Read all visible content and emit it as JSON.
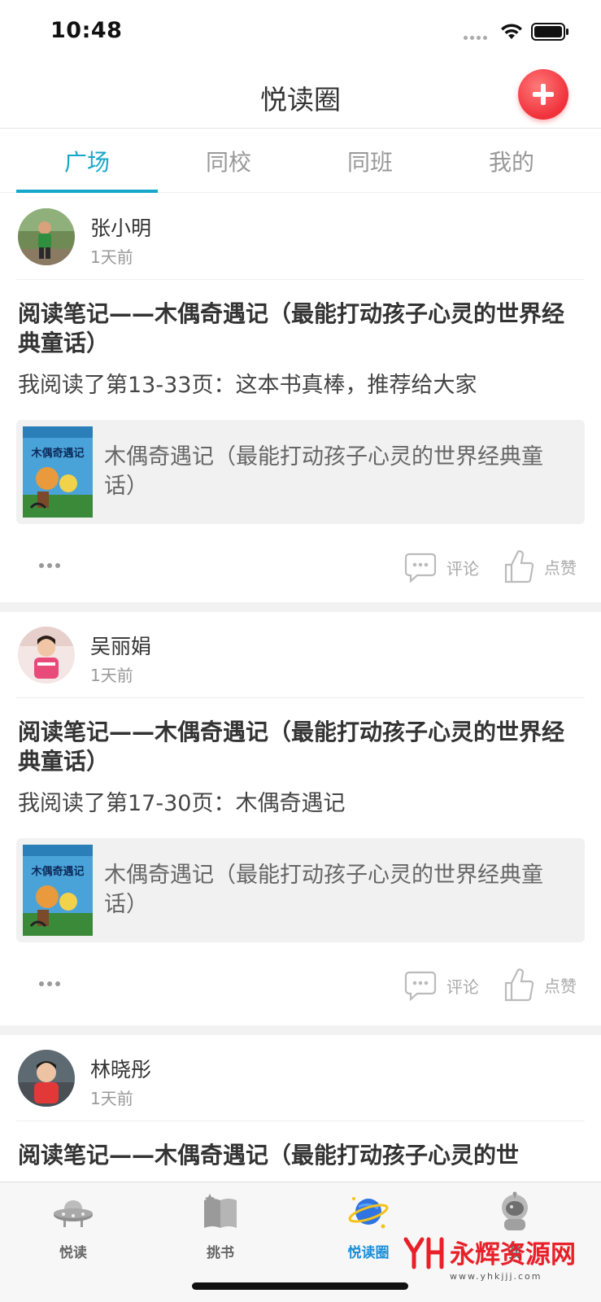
{
  "status_bar": {
    "time": "10:48"
  },
  "nav": {
    "title": "悦读圈"
  },
  "tabs": [
    {
      "label": "广场",
      "active": true
    },
    {
      "label": "同校",
      "active": false
    },
    {
      "label": "同班",
      "active": false
    },
    {
      "label": "我的",
      "active": false
    }
  ],
  "posts": [
    {
      "name": "张小明",
      "time": "1天前",
      "title": "阅读笔记——木偶奇遇记（最能打动孩子心灵的世界经典童话）",
      "body": "我阅读了第13-33页：这本书真棒，推荐给大家",
      "book_title": "木偶奇遇记（最能打动孩子心灵的世界经典童话）",
      "book_cover_text": "木偶奇遇记",
      "comment_label": "评论",
      "like_label": "点赞"
    },
    {
      "name": "吴丽娟",
      "time": "1天前",
      "title": "阅读笔记——木偶奇遇记（最能打动孩子心灵的世界经典童话）",
      "body": "我阅读了第17-30页：木偶奇遇记",
      "book_title": "木偶奇遇记（最能打动孩子心灵的世界经典童话）",
      "book_cover_text": "木偶奇遇记",
      "comment_label": "评论",
      "like_label": "点赞"
    },
    {
      "name": "林晓彤",
      "time": "1天前",
      "title": "阅读笔记——木偶奇遇记（最能打动孩子心灵的世"
    }
  ],
  "tabbar": [
    {
      "label": "悦读",
      "icon": "ufo-icon",
      "active": false
    },
    {
      "label": "挑书",
      "icon": "book-icon",
      "active": false
    },
    {
      "label": "悦读圈",
      "icon": "planet-icon",
      "active": true
    },
    {
      "label": "我",
      "icon": "astronaut-icon",
      "active": false
    }
  ],
  "watermark": {
    "text": "永辉资源网",
    "url": "www.yhkjjj.com"
  },
  "colors": {
    "accent": "#17a7c9",
    "add_button": "#f0303a",
    "tabbar_active": "#1a8ed8"
  }
}
